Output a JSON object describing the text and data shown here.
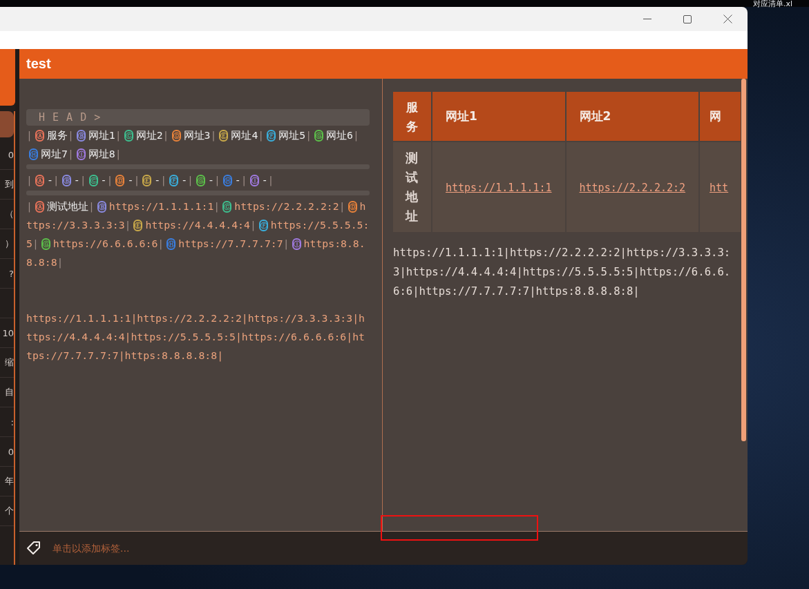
{
  "desktop": {
    "file_label": "对应清单.xl"
  },
  "sidebar": {
    "items": [
      {
        "selected": true
      },
      {
        "text": "0",
        "selected": false
      },
      {
        "text": "到",
        "selected": false
      },
      {
        "text": "（",
        "selected": false
      },
      {
        "text": "）",
        "selected": false
      },
      {
        "text": "?",
        "selected": false
      },
      {
        "selected": false
      },
      {
        "text": "10",
        "selected": false
      },
      {
        "text": "缩",
        "selected": false
      },
      {
        "text": "自",
        "selected": false
      },
      {
        "text": ":",
        "selected": false
      },
      {
        "text": "0",
        "selected": false
      },
      {
        "text": "年",
        "selected": false
      },
      {
        "text": "个",
        "selected": false
      }
    ]
  },
  "note": {
    "title": "test"
  },
  "editor": {
    "head_marker": "H E A D >",
    "rows": [
      {
        "kind": "cells",
        "start": "|",
        "cells": [
          {
            "marker": "Ⓐ",
            "color": "#e8735a",
            "kind": "text",
            "text": "服务",
            "end": "|"
          },
          {
            "marker": "Ⓑ",
            "color": "#8a8ae0",
            "kind": "text",
            "text": "网址1",
            "end": "|"
          },
          {
            "marker": "Ⓒ",
            "color": "#3dbf8f",
            "kind": "text",
            "text": "网址2",
            "end": "|"
          },
          {
            "marker": "Ⓓ",
            "color": "#e8823a",
            "kind": "text",
            "text": "网址3",
            "end": "|"
          },
          {
            "marker": "Ⓔ",
            "color": "#c9a94a",
            "kind": "text",
            "text": "网址4",
            "end": "|"
          },
          {
            "marker": "Ⓕ",
            "color": "#3aaedb",
            "kind": "text",
            "text": "网址5",
            "end": "|"
          },
          {
            "marker": "Ⓖ",
            "color": "#5cc04a",
            "kind": "text",
            "text": "网址6",
            "end": "|"
          },
          {
            "marker": "Ⓗ",
            "color": "#3a7ee0",
            "kind": "text",
            "text": "网址7",
            "end": "|"
          },
          {
            "marker": "Ⓘ",
            "color": "#a07ae0",
            "kind": "text",
            "text": "网址8",
            "end": "|"
          }
        ]
      },
      {
        "kind": "rule"
      },
      {
        "kind": "cells",
        "start": "|",
        "cells": [
          {
            "marker": "Ⓐ",
            "color": "#e8735a",
            "kind": "text",
            "text": "-",
            "end": "|"
          },
          {
            "marker": "Ⓑ",
            "color": "#8a8ae0",
            "kind": "text",
            "text": "-",
            "end": "|"
          },
          {
            "marker": "Ⓒ",
            "color": "#3dbf8f",
            "kind": "text",
            "text": "-",
            "end": "|"
          },
          {
            "marker": "Ⓓ",
            "color": "#e8823a",
            "kind": "text",
            "text": "-",
            "end": "|"
          },
          {
            "marker": "Ⓔ",
            "color": "#c9a94a",
            "kind": "text",
            "text": "-",
            "end": "|"
          },
          {
            "marker": "Ⓕ",
            "color": "#3aaedb",
            "kind": "text",
            "text": "-",
            "end": "|"
          },
          {
            "marker": "Ⓖ",
            "color": "#5cc04a",
            "kind": "text",
            "text": "-",
            "end": "|"
          },
          {
            "marker": "Ⓗ",
            "color": "#3a7ee0",
            "kind": "text",
            "text": "-",
            "end": "|"
          },
          {
            "marker": "Ⓘ",
            "color": "#a07ae0",
            "kind": "text",
            "text": "-",
            "end": "|"
          }
        ]
      },
      {
        "kind": "rule"
      },
      {
        "kind": "cells",
        "start": "|",
        "cells": [
          {
            "marker": "Ⓐ",
            "color": "#e8735a",
            "kind": "text",
            "text": "测试地址",
            "end": "|"
          },
          {
            "marker": "Ⓑ",
            "color": "#8a8ae0",
            "kind": "url",
            "text": "https://1.1.1.1:1",
            "end": "|"
          },
          {
            "marker": "Ⓒ",
            "color": "#3dbf8f",
            "kind": "url",
            "text": "https://2.2.2.2:2",
            "end": "|"
          },
          {
            "marker": "Ⓓ",
            "color": "#e8823a",
            "kind": "url",
            "text": "https://3.3.3.3:3",
            "end": "|"
          },
          {
            "marker": "Ⓔ",
            "color": "#c9a94a",
            "kind": "url",
            "text": "https://4.4.4.4:4",
            "end": "|"
          },
          {
            "marker": "Ⓕ",
            "color": "#3aaedb",
            "kind": "url",
            "text": "https://5.5.5.5:5",
            "end": "|"
          },
          {
            "marker": "Ⓖ",
            "color": "#5cc04a",
            "kind": "url",
            "text": "https://6.6.6.6:6",
            "end": "|"
          },
          {
            "marker": "Ⓗ",
            "color": "#3a7ee0",
            "kind": "url",
            "text": "https://7.7.7.7:7",
            "end": "|"
          },
          {
            "marker": "Ⓘ",
            "color": "#a07ae0",
            "kind": "url",
            "text": "https:8.8.8.8:8",
            "end": "|"
          }
        ]
      }
    ],
    "paragraph": "https://1.1.1.1:1|https://2.2.2.2:2|https://3.3.3.3:3|https://4.4.4.4:4|https://5.5.5.5:5|https://6.6.6.6:6|https://7.7.7.7:7|https:8.8.8.8:8|"
  },
  "preview": {
    "table": {
      "columns": [
        "服务",
        "网址1",
        "网址2",
        "网"
      ],
      "rows": [
        [
          "测试地址",
          "https://1.1.1.1:1",
          "https://2.2.2.2:2",
          "htt"
        ]
      ]
    },
    "paragraph": "https://1.1.1.1:1|https://2.2.2.2:2|https://3.3.3.3:3|https://4.4.4.4:4|https://5.5.5.5:5|https://6.6.6.6:6|https://7.7.7.7:7|https:8.8.8.8:8|"
  },
  "footer": {
    "tag_placeholder": "单击以添加标签..."
  }
}
